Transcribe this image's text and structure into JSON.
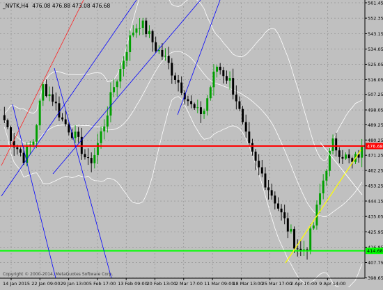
{
  "window": {
    "title": "_NVTK,H4",
    "ohlc": "476.08 476.88 473.08 476.68"
  },
  "colors": {
    "background": "#c0c0c0",
    "grid": "#808080",
    "bull_candle": "#00a000",
    "bear_candle": "#000000",
    "bollinger": "#ffffff",
    "support_line": "#00ff00",
    "resistance_line": "#ff0000",
    "trend_channel": "#0000ff",
    "fib_line": "#ff2020",
    "uptrend_line": "#ffff00",
    "white_line": "#ffffff",
    "price_label_bg": "#ff0000",
    "support_label_bg": "#00ff00"
  },
  "price_labels": {
    "current": "476.68",
    "support": "414.68"
  },
  "footer_text": "Copyright © 2000-2014, MetaQuotes Software Corp.",
  "chart_data": {
    "type": "candlestick",
    "title": "",
    "y_axis": {
      "min": 398.5,
      "max": 561.45,
      "ticks": [
        "561.45",
        "552.35",
        "543.15",
        "534.05",
        "525.05",
        "516.05",
        "507.25",
        "498.05",
        "489.25",
        "480.25",
        "471.25",
        "462.25",
        "453.25",
        "444.15",
        "435.05",
        "425.95",
        "416.85",
        "407.75",
        "398.65"
      ]
    },
    "x_axis": {
      "ticks": [
        "14 Jan 2015",
        "22 Jan 09:00",
        "29 Jan 13:00",
        "5 Feb 17:00",
        "13 Feb 09:00",
        "20 Feb 13:00",
        "2 Mar 17:00",
        "11 Mar 09:00",
        "18 Mar 13:00",
        "25 Mar 17:00",
        "2 Apr 10:00",
        "9 Apr 14:00"
      ]
    },
    "horizontal_lines": [
      {
        "name": "resistance",
        "price": 476.68
      },
      {
        "name": "support",
        "price": 414.68
      }
    ],
    "close_path": [
      [
        0,
        492
      ],
      [
        3,
        478
      ],
      [
        6,
        470
      ],
      [
        9,
        480
      ],
      [
        12,
        512
      ],
      [
        15,
        505
      ],
      [
        18,
        492
      ],
      [
        21,
        485
      ],
      [
        24,
        475
      ],
      [
        26,
        466
      ],
      [
        28,
        472
      ],
      [
        31,
        490
      ],
      [
        34,
        512
      ],
      [
        36,
        522
      ],
      [
        38,
        535
      ],
      [
        40,
        545
      ],
      [
        42,
        550
      ],
      [
        44,
        545
      ],
      [
        47,
        535
      ],
      [
        50,
        528
      ],
      [
        53,
        518
      ],
      [
        56,
        508
      ],
      [
        58,
        500
      ],
      [
        60,
        496
      ],
      [
        62,
        498
      ],
      [
        64,
        512
      ],
      [
        66,
        524
      ],
      [
        68,
        520
      ],
      [
        70,
        515
      ],
      [
        72,
        505
      ],
      [
        74,
        488
      ],
      [
        76,
        475
      ],
      [
        78,
        466
      ],
      [
        80,
        460
      ],
      [
        82,
        452
      ],
      [
        84,
        445
      ],
      [
        86,
        436
      ],
      [
        88,
        428
      ],
      [
        90,
        420
      ],
      [
        92,
        414
      ],
      [
        94,
        418
      ],
      [
        96,
        430
      ],
      [
        98,
        448
      ],
      [
        100,
        465
      ],
      [
        102,
        478
      ],
      [
        104,
        474
      ],
      [
        106,
        470
      ],
      [
        108,
        466
      ],
      [
        110,
        472
      ],
      [
        111,
        476.68
      ]
    ]
  }
}
